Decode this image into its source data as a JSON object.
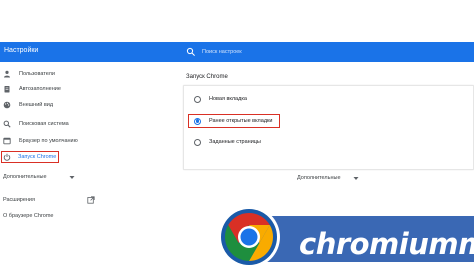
{
  "header": {
    "title": "Настройки",
    "search_placeholder": "Поиск настроек"
  },
  "sidebar": {
    "items": [
      {
        "label": "Пользователи",
        "icon": "person-icon"
      },
      {
        "label": "Автозаполнение",
        "icon": "clipboard-icon"
      },
      {
        "label": "Внешний вид",
        "icon": "palette-icon"
      },
      {
        "label": "Поисковая система",
        "icon": "search-icon"
      },
      {
        "label": "Браузер по умолчанию",
        "icon": "browser-icon"
      },
      {
        "label": "Запуск Chrome",
        "icon": "power-icon",
        "active": true
      }
    ],
    "advanced_label": "Дополнительные",
    "extensions_label": "Расширения",
    "about_label": "О браузере Chrome"
  },
  "main": {
    "section_title": "Запуск Chrome",
    "options": [
      {
        "label": "Новая вкладка",
        "selected": false
      },
      {
        "label": "Ранее открытые вкладки",
        "selected": true
      },
      {
        "label": "Заданные страницы",
        "selected": false
      }
    ],
    "advanced_label": "Дополнительные"
  },
  "watermark": {
    "text": "chromiumm"
  },
  "colors": {
    "header_blue": "#1a73e8",
    "highlight_red": "#d93025",
    "watermark_blue": "#3a68b4"
  }
}
